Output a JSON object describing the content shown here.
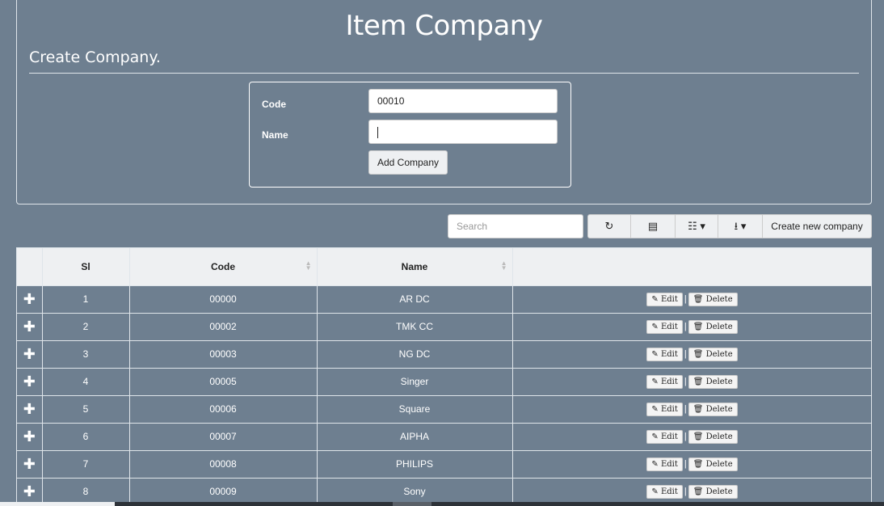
{
  "header": {
    "title": "Item Company",
    "subtitle": "Create Company."
  },
  "form": {
    "code_label": "Code",
    "code_value": "00010",
    "name_label": "Name",
    "name_value": "",
    "submit_label": "Add Company"
  },
  "toolbar": {
    "search_placeholder": "Search",
    "refresh_icon": "refresh-icon",
    "toggle_icon": "list-icon",
    "columns_icon": "columns-icon",
    "export_icon": "export-icon",
    "create_label": "Create new company"
  },
  "table": {
    "columns": [
      "Sl",
      "Code",
      "Name"
    ],
    "edit_label": "Edit",
    "delete_label": "Delete",
    "rows": [
      {
        "sl": "1",
        "code": "00000",
        "name": "AR DC"
      },
      {
        "sl": "2",
        "code": "00002",
        "name": "TMK CC"
      },
      {
        "sl": "3",
        "code": "00003",
        "name": "NG DC"
      },
      {
        "sl": "4",
        "code": "00005",
        "name": "Singer"
      },
      {
        "sl": "5",
        "code": "00006",
        "name": "Square"
      },
      {
        "sl": "6",
        "code": "00007",
        "name": "AIPHA"
      },
      {
        "sl": "7",
        "code": "00008",
        "name": "PHILIPS"
      },
      {
        "sl": "8",
        "code": "00009",
        "name": "Sony"
      }
    ]
  }
}
